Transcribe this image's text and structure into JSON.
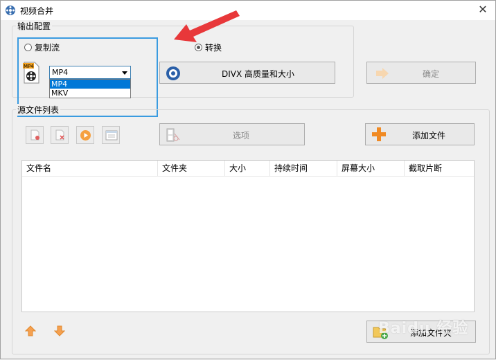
{
  "window": {
    "title": "视频合并",
    "close_glyph": "✕"
  },
  "output_config": {
    "group_label": "输出配置",
    "radio_copy": {
      "label": "复制流",
      "selected": false
    },
    "radio_convert": {
      "label": "转换",
      "selected": true
    },
    "format_select": {
      "value": "MP4",
      "options": [
        "MP4",
        "MKV"
      ],
      "highlighted": "MP4"
    },
    "quality_button": "DIVX 高质量和大小",
    "ok_button": "确定"
  },
  "source_list": {
    "group_label": "源文件列表",
    "options_button": "选项",
    "add_file_button": "添加文件",
    "add_folder_button": "添加文件夹",
    "columns": [
      "文件名",
      "文件夹",
      "大小",
      "持续时间",
      "屏幕大小",
      "截取片断"
    ],
    "rows": []
  },
  "colors": {
    "highlight_box": "#3a9be0",
    "annotation_arrow": "#e8383a",
    "selection": "#0078d7"
  },
  "icons": [
    "film-reel-icon",
    "mp4-file-icon",
    "gear-disc-icon",
    "arrow-right-icon",
    "delete-file-icon",
    "remove-file-icon",
    "play-icon",
    "properties-icon",
    "film-scissors-icon",
    "plus-icon",
    "add-folder-icon",
    "arrow-up-icon",
    "arrow-down-icon"
  ],
  "watermark": "Baidu 经验"
}
